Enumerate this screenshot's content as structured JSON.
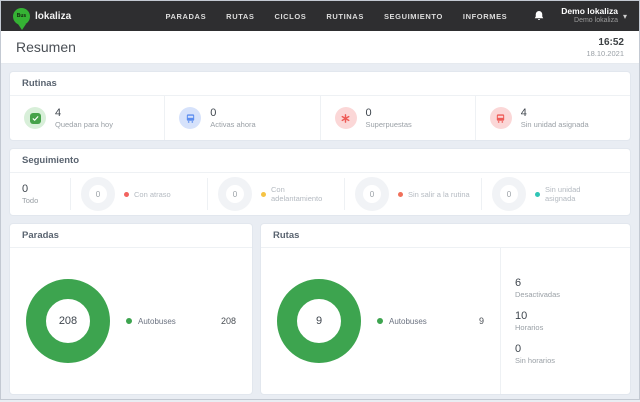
{
  "navbar": {
    "logo": {
      "pin_text": "Bus",
      "brand": "lokaliza"
    },
    "items": [
      {
        "label": "PARADAS"
      },
      {
        "label": "RUTAS"
      },
      {
        "label": "CICLOS"
      },
      {
        "label": "RUTINAS"
      },
      {
        "label": "SEGUIMIENTO"
      },
      {
        "label": "INFORMES"
      }
    ],
    "user": {
      "name": "Demo lokaliza",
      "org": "Demo lokaliza"
    }
  },
  "header": {
    "title": "Resumen",
    "time": "16:52",
    "date": "18.10.2021"
  },
  "rutinas": {
    "title": "Rutinas",
    "stats": [
      {
        "value": "4",
        "label": "Quedan para hoy",
        "icon": "check-badge-icon",
        "color": "#46a24a"
      },
      {
        "value": "0",
        "label": "Activas ahora",
        "icon": "bus-icon",
        "color": "#5b8def"
      },
      {
        "value": "0",
        "label": "Superpuestas",
        "icon": "asterisk-icon",
        "color": "#ee5a56"
      },
      {
        "value": "4",
        "label": "Sin unidad asignada",
        "icon": "bus-icon",
        "color": "#ee5a56"
      }
    ]
  },
  "seguimiento": {
    "title": "Seguimiento",
    "total": {
      "value": "0",
      "label": "Todo"
    },
    "rings": [
      {
        "value": "0",
        "label": "Con atraso",
        "dot_color": "#f2635f"
      },
      {
        "value": "0",
        "label": "Con adelantamiento",
        "dot_color": "#f5c344"
      },
      {
        "value": "0",
        "label": "Sin salir a la rutina",
        "dot_color": "#f0705a"
      },
      {
        "value": "0",
        "label": "Sin unidad asignada",
        "dot_color": "#2fc5b6"
      }
    ]
  },
  "paradas": {
    "title": "Paradas",
    "donut": {
      "value": "208",
      "color": "#3da44f"
    },
    "legend": {
      "label": "Autobuses",
      "value": "208",
      "dot_color": "#3da44f"
    }
  },
  "rutas": {
    "title": "Rutas",
    "donut": {
      "value": "9",
      "color": "#3da44f"
    },
    "legend": {
      "label": "Autobuses",
      "value": "9",
      "dot_color": "#3da44f"
    },
    "stats": [
      {
        "value": "6",
        "label": "Desactivadas"
      },
      {
        "value": "10",
        "label": "Horarios"
      },
      {
        "value": "0",
        "label": "Sin horarios"
      }
    ]
  },
  "colors": {
    "navbar_bg": "#2e2e30",
    "page_bg": "#e9edf3",
    "accent_green": "#3da44f",
    "accent_blue": "#5b8def",
    "accent_red": "#ee5a56",
    "ring_grey": "#f1f3f6"
  }
}
